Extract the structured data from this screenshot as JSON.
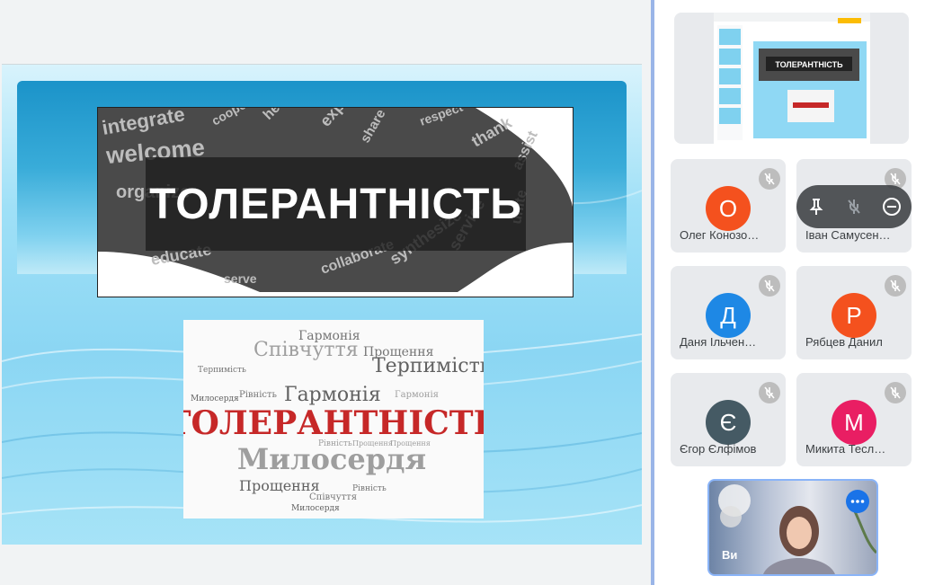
{
  "slide": {
    "banner_text": "ТОЛЕРАНТНІСТЬ",
    "hand_words": [
      "integrate",
      "welcome",
      "cooperate",
      "help out",
      "expand",
      "share",
      "respect",
      "thank",
      "assist",
      "organize",
      "educate",
      "collaborate",
      "synthesize",
      "service",
      "unite",
      "serve"
    ],
    "cloud_words": {
      "big_red": "ТОЛЕРАНТНІСТЬ",
      "big_grey": "Милосердя",
      "medium": [
        "Гармонія",
        "Співчуття",
        "Терпимість",
        "Прощення",
        "Гармонія",
        "Прощення"
      ],
      "small": [
        "Рівність",
        "Прощення",
        "Милосердя",
        "Терпимість",
        "Рівність",
        "Гармонія",
        "Співчуття",
        "Прощення",
        "Рівність",
        "Милосердя"
      ]
    }
  },
  "presenter_thumbnail": {
    "slide_text": "ТОЛЕРАНТНІСТЬ"
  },
  "participants": [
    {
      "initial": "О",
      "name": "Олег Конозо…",
      "color": "#f4511e"
    },
    {
      "initial": "",
      "name": "Іван Самусен…",
      "color": "#e8eaed"
    },
    {
      "initial": "Д",
      "name": "Даня Ільчен…",
      "color": "#1e88e5"
    },
    {
      "initial": "Р",
      "name": "Рябцев Данил",
      "color": "#f4511e"
    },
    {
      "initial": "Є",
      "name": "Єгор Єлфімов",
      "color": "#455a64"
    },
    {
      "initial": "М",
      "name": "Микита Тесл…",
      "color": "#e91e63"
    }
  ],
  "self": {
    "label": "Ви"
  },
  "icons": {
    "muted": "mic-off-icon",
    "pin": "pin-icon",
    "remove": "remove-icon",
    "more": "more-options-icon"
  }
}
